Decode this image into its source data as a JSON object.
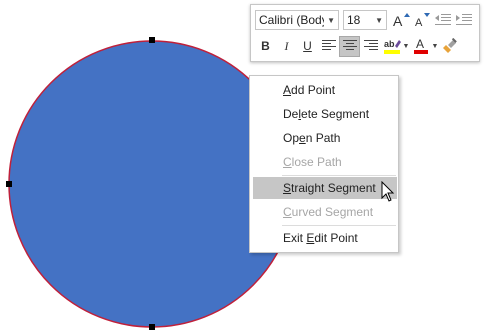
{
  "shape": {
    "fill": "#4472c4",
    "outline": "#c0203a",
    "handle_color": "#000000"
  },
  "mini_toolbar": {
    "font_name": "Calibri (Body)",
    "font_size": "18",
    "row1_icons": [
      "grow-font-icon",
      "shrink-font-icon",
      "decrease-indent-icon",
      "increase-indent-icon"
    ],
    "bold": "B",
    "italic": "I",
    "underline": "U",
    "highlight_color": "#ffff00",
    "font_color": "#e00000",
    "font_color_letter": "A",
    "row2_icons": [
      "align-left-icon",
      "align-center-icon",
      "align-right-icon",
      "highlighter-icon",
      "font-color-icon",
      "format-painter-icon"
    ]
  },
  "context_menu": {
    "items": [
      {
        "label": "Add Point",
        "underline_index": 0,
        "enabled": true
      },
      {
        "label": "Delete Segment",
        "underline_index": 2,
        "enabled": true
      },
      {
        "label": "Open Path",
        "underline_index": 2,
        "enabled": true
      },
      {
        "label": "Close Path",
        "underline_index": 0,
        "enabled": false
      },
      {
        "label": "Straight Segment",
        "underline_index": 0,
        "enabled": true,
        "highlighted": true
      },
      {
        "label": "Curved Segment",
        "underline_index": 0,
        "enabled": false
      },
      {
        "label": "Exit Edit Point",
        "underline_index": 5,
        "enabled": true
      }
    ]
  }
}
